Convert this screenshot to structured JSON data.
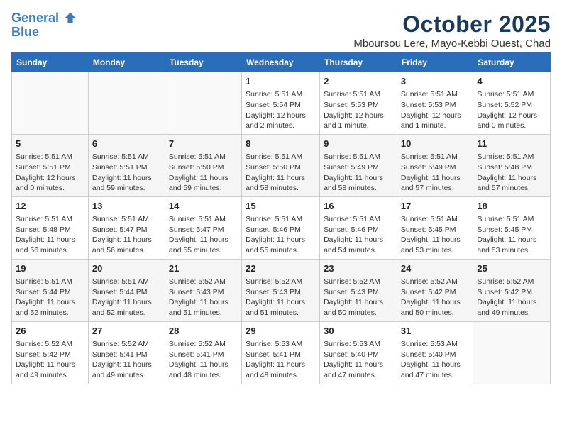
{
  "header": {
    "logo_line1": "General",
    "logo_line2": "Blue",
    "month_title": "October 2025",
    "location": "Mboursou Lere, Mayo-Kebbi Ouest, Chad"
  },
  "weekdays": [
    "Sunday",
    "Monday",
    "Tuesday",
    "Wednesday",
    "Thursday",
    "Friday",
    "Saturday"
  ],
  "weeks": [
    [
      {
        "day": "",
        "info": ""
      },
      {
        "day": "",
        "info": ""
      },
      {
        "day": "",
        "info": ""
      },
      {
        "day": "1",
        "info": "Sunrise: 5:51 AM\nSunset: 5:54 PM\nDaylight: 12 hours and 2 minutes."
      },
      {
        "day": "2",
        "info": "Sunrise: 5:51 AM\nSunset: 5:53 PM\nDaylight: 12 hours and 1 minute."
      },
      {
        "day": "3",
        "info": "Sunrise: 5:51 AM\nSunset: 5:53 PM\nDaylight: 12 hours and 1 minute."
      },
      {
        "day": "4",
        "info": "Sunrise: 5:51 AM\nSunset: 5:52 PM\nDaylight: 12 hours and 0 minutes."
      }
    ],
    [
      {
        "day": "5",
        "info": "Sunrise: 5:51 AM\nSunset: 5:51 PM\nDaylight: 12 hours and 0 minutes."
      },
      {
        "day": "6",
        "info": "Sunrise: 5:51 AM\nSunset: 5:51 PM\nDaylight: 11 hours and 59 minutes."
      },
      {
        "day": "7",
        "info": "Sunrise: 5:51 AM\nSunset: 5:50 PM\nDaylight: 11 hours and 59 minutes."
      },
      {
        "day": "8",
        "info": "Sunrise: 5:51 AM\nSunset: 5:50 PM\nDaylight: 11 hours and 58 minutes."
      },
      {
        "day": "9",
        "info": "Sunrise: 5:51 AM\nSunset: 5:49 PM\nDaylight: 11 hours and 58 minutes."
      },
      {
        "day": "10",
        "info": "Sunrise: 5:51 AM\nSunset: 5:49 PM\nDaylight: 11 hours and 57 minutes."
      },
      {
        "day": "11",
        "info": "Sunrise: 5:51 AM\nSunset: 5:48 PM\nDaylight: 11 hours and 57 minutes."
      }
    ],
    [
      {
        "day": "12",
        "info": "Sunrise: 5:51 AM\nSunset: 5:48 PM\nDaylight: 11 hours and 56 minutes."
      },
      {
        "day": "13",
        "info": "Sunrise: 5:51 AM\nSunset: 5:47 PM\nDaylight: 11 hours and 56 minutes."
      },
      {
        "day": "14",
        "info": "Sunrise: 5:51 AM\nSunset: 5:47 PM\nDaylight: 11 hours and 55 minutes."
      },
      {
        "day": "15",
        "info": "Sunrise: 5:51 AM\nSunset: 5:46 PM\nDaylight: 11 hours and 55 minutes."
      },
      {
        "day": "16",
        "info": "Sunrise: 5:51 AM\nSunset: 5:46 PM\nDaylight: 11 hours and 54 minutes."
      },
      {
        "day": "17",
        "info": "Sunrise: 5:51 AM\nSunset: 5:45 PM\nDaylight: 11 hours and 53 minutes."
      },
      {
        "day": "18",
        "info": "Sunrise: 5:51 AM\nSunset: 5:45 PM\nDaylight: 11 hours and 53 minutes."
      }
    ],
    [
      {
        "day": "19",
        "info": "Sunrise: 5:51 AM\nSunset: 5:44 PM\nDaylight: 11 hours and 52 minutes."
      },
      {
        "day": "20",
        "info": "Sunrise: 5:51 AM\nSunset: 5:44 PM\nDaylight: 11 hours and 52 minutes."
      },
      {
        "day": "21",
        "info": "Sunrise: 5:52 AM\nSunset: 5:43 PM\nDaylight: 11 hours and 51 minutes."
      },
      {
        "day": "22",
        "info": "Sunrise: 5:52 AM\nSunset: 5:43 PM\nDaylight: 11 hours and 51 minutes."
      },
      {
        "day": "23",
        "info": "Sunrise: 5:52 AM\nSunset: 5:43 PM\nDaylight: 11 hours and 50 minutes."
      },
      {
        "day": "24",
        "info": "Sunrise: 5:52 AM\nSunset: 5:42 PM\nDaylight: 11 hours and 50 minutes."
      },
      {
        "day": "25",
        "info": "Sunrise: 5:52 AM\nSunset: 5:42 PM\nDaylight: 11 hours and 49 minutes."
      }
    ],
    [
      {
        "day": "26",
        "info": "Sunrise: 5:52 AM\nSunset: 5:42 PM\nDaylight: 11 hours and 49 minutes."
      },
      {
        "day": "27",
        "info": "Sunrise: 5:52 AM\nSunset: 5:41 PM\nDaylight: 11 hours and 49 minutes."
      },
      {
        "day": "28",
        "info": "Sunrise: 5:52 AM\nSunset: 5:41 PM\nDaylight: 11 hours and 48 minutes."
      },
      {
        "day": "29",
        "info": "Sunrise: 5:53 AM\nSunset: 5:41 PM\nDaylight: 11 hours and 48 minutes."
      },
      {
        "day": "30",
        "info": "Sunrise: 5:53 AM\nSunset: 5:40 PM\nDaylight: 11 hours and 47 minutes."
      },
      {
        "day": "31",
        "info": "Sunrise: 5:53 AM\nSunset: 5:40 PM\nDaylight: 11 hours and 47 minutes."
      },
      {
        "day": "",
        "info": ""
      }
    ]
  ]
}
